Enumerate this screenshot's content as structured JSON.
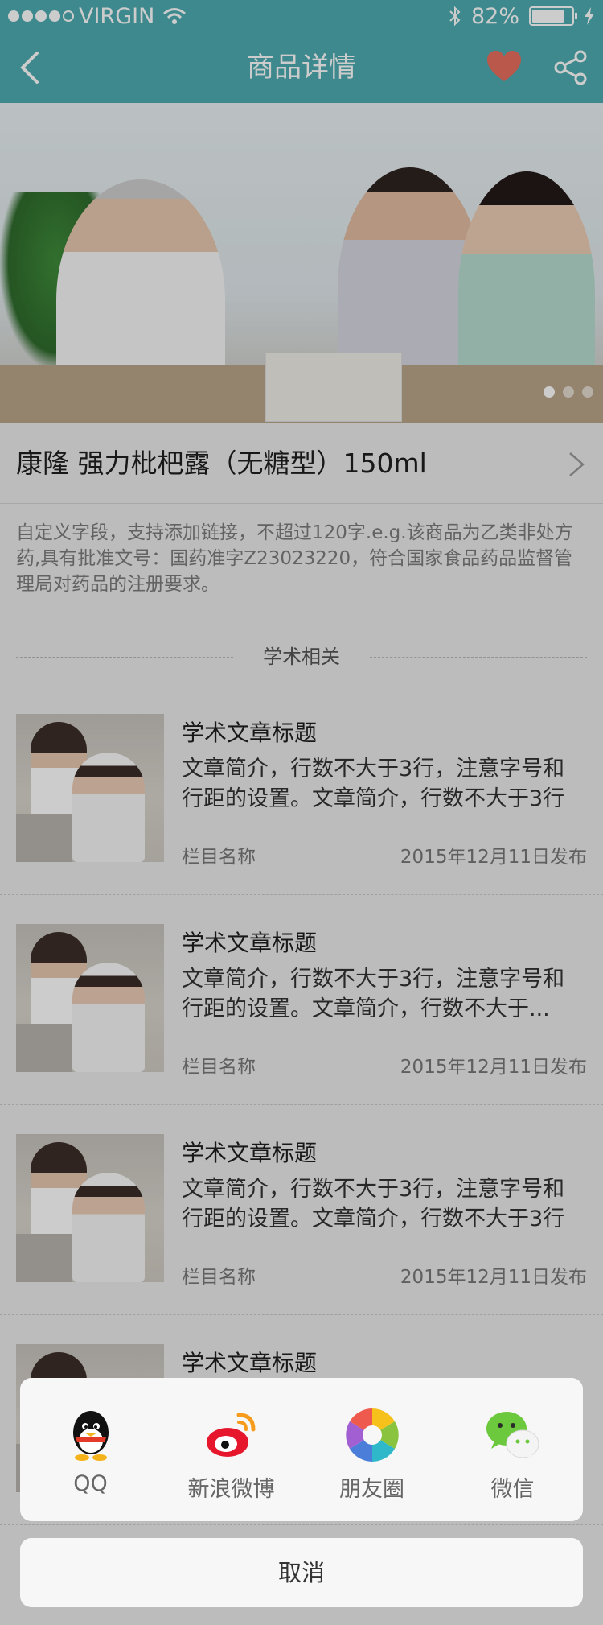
{
  "status_bar": {
    "carrier": "VIRGIN",
    "battery_text": "82%",
    "battery_level": 0.82
  },
  "nav": {
    "title": "商品详情"
  },
  "banner": {
    "page_count": 3,
    "active_page": 1
  },
  "product": {
    "title": "康隆 强力枇杷露（无糖型）150ml",
    "description": "自定义字段，支持添加链接，不超过120字.e.g.该商品为乙类非处方药,具有批准文号：国药准字Z23023220，符合国家食品药品监督管理局对药品的注册要求。"
  },
  "section": {
    "title": "学术相关"
  },
  "articles": [
    {
      "title": "学术文章标题",
      "summary": "文章简介，行数不大于3行，注意字号和行距的设置。文章简介，行数不大于3行",
      "column": "栏目名称",
      "date": "2015年12月11日发布"
    },
    {
      "title": "学术文章标题",
      "summary": "文章简介，行数不大于3行，注意字号和行距的设置。文章简介，行数不大于...",
      "column": "栏目名称",
      "date": "2015年12月11日发布"
    },
    {
      "title": "学术文章标题",
      "summary": "文章简介，行数不大于3行，注意字号和行距的设置。文章简介，行数不大于3行",
      "column": "栏目名称",
      "date": "2015年12月11日发布"
    },
    {
      "title": "学术文章标题",
      "summary": "",
      "column": "",
      "date": ""
    }
  ],
  "share_sheet": {
    "options": [
      {
        "label": "QQ",
        "icon": "qq-icon"
      },
      {
        "label": "新浪微博",
        "icon": "weibo-icon"
      },
      {
        "label": "朋友圈",
        "icon": "moments-icon"
      },
      {
        "label": "微信",
        "icon": "wechat-icon"
      }
    ],
    "cancel_label": "取消"
  },
  "colors": {
    "header": "#4eacb1",
    "favorite": "#e96f5e"
  }
}
